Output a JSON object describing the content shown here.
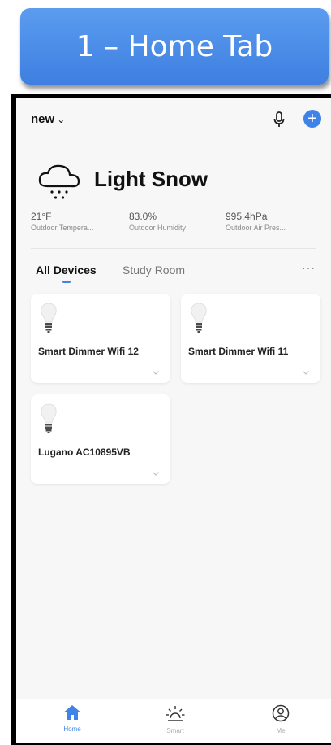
{
  "banner": {
    "title": "1 – Home Tab"
  },
  "header": {
    "home_name": "new",
    "chevron": "⌄",
    "plus": "+"
  },
  "weather": {
    "condition": "Light Snow",
    "stats": [
      {
        "value": "21°F",
        "label": "Outdoor Tempera..."
      },
      {
        "value": "83.0%",
        "label": "Outdoor Humidity"
      },
      {
        "value": "995.4hPa",
        "label": "Outdoor Air Pres..."
      }
    ]
  },
  "tabs": [
    {
      "label": "All Devices",
      "active": true
    },
    {
      "label": "Study Room",
      "active": false
    }
  ],
  "more_label": "···",
  "devices": [
    {
      "name": "Smart Dimmer Wifi 12"
    },
    {
      "name": "Smart Dimmer Wifi 11"
    },
    {
      "name": "Lugano AC10895VB"
    }
  ],
  "bottom_nav": [
    {
      "label": "Home",
      "icon": "home-icon",
      "active": true
    },
    {
      "label": "Smart",
      "icon": "sun-icon",
      "active": false
    },
    {
      "label": "Me",
      "icon": "user-icon",
      "active": false
    }
  ],
  "colors": {
    "accent": "#3f82e8",
    "banner": "#4a8ce8"
  }
}
